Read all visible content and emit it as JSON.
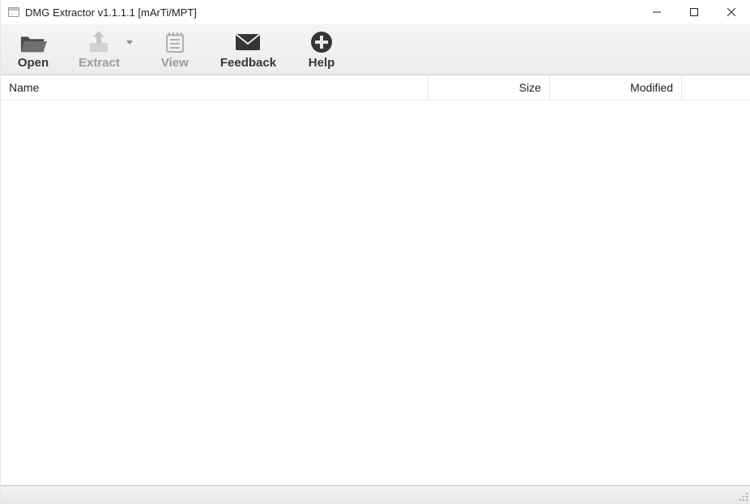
{
  "window": {
    "title": "DMG Extractor v1.1.1.1 [mArTi/MPT]"
  },
  "toolbar": {
    "open": {
      "label": "Open",
      "enabled": true
    },
    "extract": {
      "label": "Extract",
      "enabled": false,
      "has_dropdown": true
    },
    "view": {
      "label": "View",
      "enabled": false
    },
    "feedback": {
      "label": "Feedback",
      "enabled": true
    },
    "help": {
      "label": "Help",
      "enabled": true
    }
  },
  "columns": {
    "name": "Name",
    "size": "Size",
    "modified": "Modified"
  },
  "rows": []
}
